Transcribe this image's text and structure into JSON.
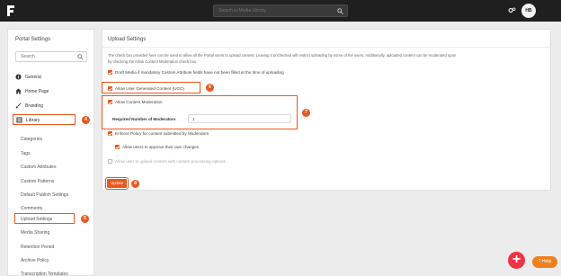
{
  "topbar": {
    "search_placeholder": "Search in Media Library",
    "avatar_initials": "HB"
  },
  "sidebar": {
    "title": "Portal Settings",
    "search_placeholder": "Search",
    "items": [
      {
        "label": "General",
        "icon": "info-icon"
      },
      {
        "label": "Home Page",
        "icon": "home-icon"
      },
      {
        "label": "Branding",
        "icon": "brush-icon"
      },
      {
        "label": "Library",
        "icon": "library-icon"
      }
    ],
    "sub_items": [
      {
        "label": "Categories"
      },
      {
        "label": "Tags"
      },
      {
        "label": "Custom Attributes"
      },
      {
        "label": "Custom Patterns"
      },
      {
        "label": "Default Publish Settings"
      },
      {
        "label": "Comments"
      },
      {
        "label": "Upload Settings"
      },
      {
        "label": "Media Sharing"
      },
      {
        "label": "Retention Period"
      },
      {
        "label": "Archive Policy"
      },
      {
        "label": "Transcription Templates"
      }
    ]
  },
  "panel": {
    "title": "Upload Settings",
    "intro_line1": "The check box provided here can be used to allow all the Portal users to upload content. Leaving it unchecked will restrict uploading by some of the users. Additionally, uploaded content can be moderated upon",
    "intro_line2": "by checking the Allow Content Moderation check box.",
    "options": {
      "draft_media": "Draft Media if mandatory Custom Attribute fields have not been filled at the time of uploading",
      "allow_ugc": "Allow User Generated Content (UGC)",
      "allow_moderation": "Allow Content Moderation",
      "required_moderators_label": "Required Number of Moderators",
      "required_moderators_value": "1",
      "enforce_policy": "Enforce Policy for content submitted by Moderators",
      "approve_own": "Allow users to approve their own changes",
      "custom_processing": "Allow user to upload content with custom processing options"
    },
    "update_label": "Update"
  },
  "callouts": {
    "library": "4",
    "upload_settings": "5",
    "ugc": "6",
    "moderation": "7",
    "update": "8"
  },
  "widgets": {
    "fab_label": "+",
    "help_label": "Help"
  },
  "colors": {
    "accent": "#e8581f",
    "topbar": "#1f1f1f",
    "fab": "#ee3446",
    "help": "#f07f1f"
  }
}
